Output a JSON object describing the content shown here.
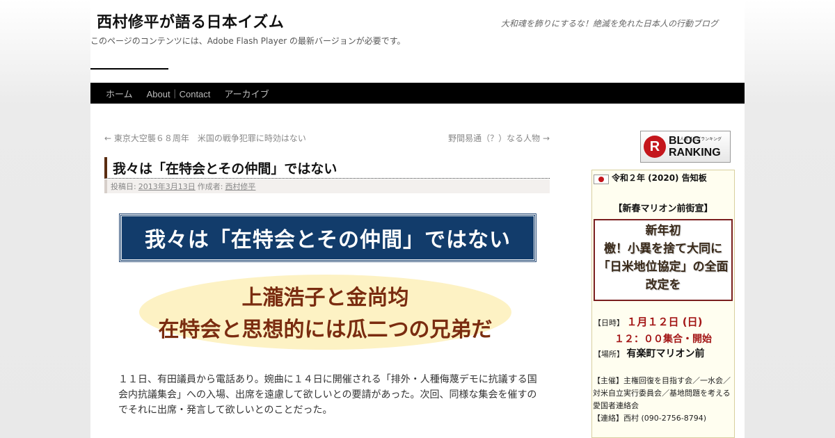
{
  "site": {
    "title": "西村修平が語る日本イズム",
    "description": "大和魂を飾りにするな！絶滅を免れた日本人の行動ブログ",
    "flash_note": "このページのコンテンツには、Adobe Flash Player の最新バージョンが必要です。"
  },
  "nav": {
    "items": [
      {
        "label": "ホーム"
      },
      {
        "label": "About｜Contact"
      },
      {
        "label": "アーカイブ"
      }
    ]
  },
  "post_nav": {
    "prev": "← 東京大空襲６８周年　米国の戦争犯罪に時効はない",
    "next": "野間易通（？）なる人物 →"
  },
  "post": {
    "title": "我々は「在特会とその仲間」ではない",
    "meta_posted_prefix": "投稿日:",
    "meta_date": "2013年3月13日",
    "meta_author_prefix": "作成者:",
    "meta_author": "西村修平",
    "banner_text": "我々は「在特会とその仲間」ではない",
    "oval_line1": "上瀧浩子と金尚均",
    "oval_line2": "在特会と思想的には瓜二つの兄弟だ",
    "body_paragraph": "１１日、有田議員から電話あり。婉曲に１４日に開催される「排外・人種侮蔑デモに抗議する国会内抗議集会」への入場、出席を遠慮して欲しいとの要請があった。次回、同様な集会を催すのでそれに出席・発言して欲しいとのことだった。"
  },
  "sidebar": {
    "blog_ranking": {
      "letter": "R",
      "line1": "BLOG",
      "line2": "RANKING",
      "small": "人気ブログランキング"
    },
    "notice": {
      "title": "令和２年 (2020) 告知板",
      "rally_title": "【新春マリオン前街宣】",
      "rally_text": "新年初\n檄！小異を捨て大同に「日米地位協定」の全面改定を",
      "date_label": "【日時】",
      "date_value": "１月１２日 (日)",
      "time_value": "１２：００集合・開始",
      "place_label": "【場所】",
      "place_value": "有楽町マリオン前",
      "organizer": "【主催】主権回復を目指す会／一水会／対米自立実行委員会／基地問題を考える愛国者連絡会",
      "contact": "【連絡】西村 (090-2756-8794)"
    }
  },
  "colors": {
    "nav_bg": "#000000",
    "banner_bg": "#123c6b",
    "oval_bg": "#fdf2c4",
    "accent_red": "#a31616"
  }
}
